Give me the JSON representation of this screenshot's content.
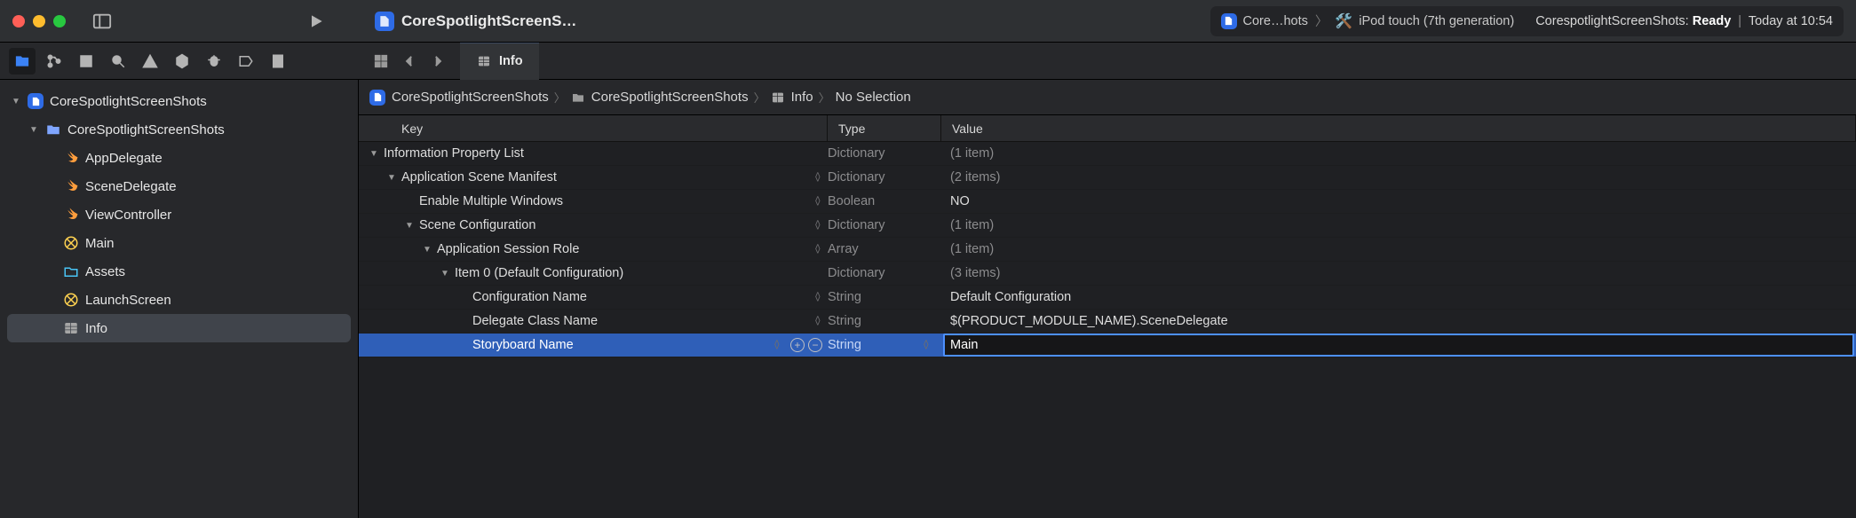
{
  "titlebar": {
    "doc_title": "CoreSpotlightScreenS…",
    "scheme_app": "Core…hots",
    "scheme_device": "iPod touch (7th generation)",
    "status_project": "CorespotlightScreenShots:",
    "status_ready": "Ready",
    "status_time": "Today at 10:54"
  },
  "tab": {
    "label": "Info"
  },
  "crumbs": {
    "seg1": "CoreSpotlightScreenShots",
    "seg2": "CoreSpotlightScreenShots",
    "seg3": "Info",
    "seg4": "No Selection"
  },
  "sidebar": {
    "root": "CoreSpotlightScreenShots",
    "group": "CoreSpotlightScreenShots",
    "items": [
      {
        "label": "AppDelegate"
      },
      {
        "label": "SceneDelegate"
      },
      {
        "label": "ViewController"
      },
      {
        "label": "Main"
      },
      {
        "label": "Assets"
      },
      {
        "label": "LaunchScreen"
      },
      {
        "label": "Info"
      }
    ]
  },
  "plist": {
    "headers": {
      "key": "Key",
      "type": "Type",
      "value": "Value"
    },
    "rows": [
      {
        "indent": 0,
        "disc": "open",
        "key": "Information Property List",
        "type": "Dictionary",
        "value": "(1 item)",
        "dim": true,
        "stepper": false
      },
      {
        "indent": 1,
        "disc": "open",
        "key": "Application Scene Manifest",
        "type": "Dictionary",
        "value": "(2 items)",
        "dim": true,
        "stepper": true
      },
      {
        "indent": 2,
        "disc": "none",
        "key": "Enable Multiple Windows",
        "type": "Boolean",
        "value": "NO",
        "dim": false,
        "stepper": true
      },
      {
        "indent": 2,
        "disc": "open",
        "key": "Scene Configuration",
        "type": "Dictionary",
        "value": "(1 item)",
        "dim": true,
        "stepper": true
      },
      {
        "indent": 3,
        "disc": "open",
        "key": "Application Session Role",
        "type": "Array",
        "value": "(1 item)",
        "dim": true,
        "stepper": true
      },
      {
        "indent": 4,
        "disc": "open",
        "key": "Item 0 (Default Configuration)",
        "type": "Dictionary",
        "value": "(3 items)",
        "dim": true,
        "stepper": false
      },
      {
        "indent": 5,
        "disc": "none",
        "key": "Configuration Name",
        "type": "String",
        "value": "Default Configuration",
        "dim": false,
        "stepper": true
      },
      {
        "indent": 5,
        "disc": "none",
        "key": "Delegate Class Name",
        "type": "String",
        "value": "$(PRODUCT_MODULE_NAME).SceneDelegate",
        "dim": false,
        "stepper": true
      },
      {
        "indent": 5,
        "disc": "none",
        "key": "Storyboard Name",
        "type": "String",
        "value": "Main",
        "dim": false,
        "stepper": true,
        "selected": true,
        "editing": true
      }
    ]
  }
}
